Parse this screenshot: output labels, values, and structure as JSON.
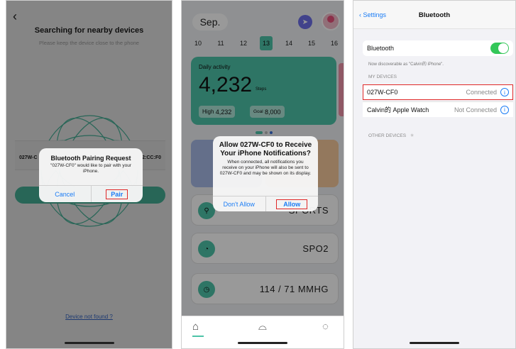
{
  "colors": {
    "accent_green": "#4dc3a8",
    "ios_blue": "#1a7cf5",
    "highlight_red": "#e02828",
    "toggle_green": "#34c759"
  },
  "panel1": {
    "back_icon": "chevron-left-icon",
    "title": "Searching for nearby devices",
    "subtitle": "Please keep the device close to the phone",
    "device_left": "027W-C",
    "device_right": "2:CC:F0",
    "alert": {
      "title": "Bluetooth Pairing Request",
      "body": "\"027W-CF0\" would like to pair with your iPhone.",
      "cancel": "Cancel",
      "confirm": "Pair"
    },
    "not_found_link": "Device not found ?"
  },
  "panel2": {
    "month": "Sep.",
    "dates": [
      "10",
      "11",
      "12",
      "13",
      "14",
      "15",
      "16"
    ],
    "selected_date": "13",
    "card": {
      "title": "Daily activity",
      "steps": "4,232",
      "unit": "Steps",
      "high_label": "High",
      "high_value": "4,232",
      "goal_label": "Goal",
      "goal_value": "8,000"
    },
    "alert": {
      "title": "Allow 027W-CF0 to Receive Your iPhone Notifications?",
      "body": "When connected, all notifications you receive on your iPhone will also be sent to 027W-CF0 and may be shown on its display.",
      "deny": "Don't Allow",
      "allow": "Allow"
    },
    "rows": [
      {
        "icon": "run-icon",
        "label": "SPORTS"
      },
      {
        "icon": "spo2-icon",
        "label": "SPO2"
      },
      {
        "icon": "blood-pressure-icon",
        "label": "114 / 71 MMHG"
      }
    ],
    "tabs": [
      "home-icon",
      "watch-icon",
      "settings-icon"
    ]
  },
  "panel3": {
    "back_label": "Settings",
    "nav_title": "Bluetooth",
    "bt_label": "Bluetooth",
    "bt_on": true,
    "discoverable_note": "Now discoverable as \"Calvin的 iPhone\".",
    "my_devices_header": "MY DEVICES",
    "devices": [
      {
        "name": "027W-CF0",
        "status": "Connected"
      },
      {
        "name": "Calvin的 Apple Watch",
        "status": "Not Connected"
      }
    ],
    "other_devices_header": "OTHER DEVICES"
  }
}
